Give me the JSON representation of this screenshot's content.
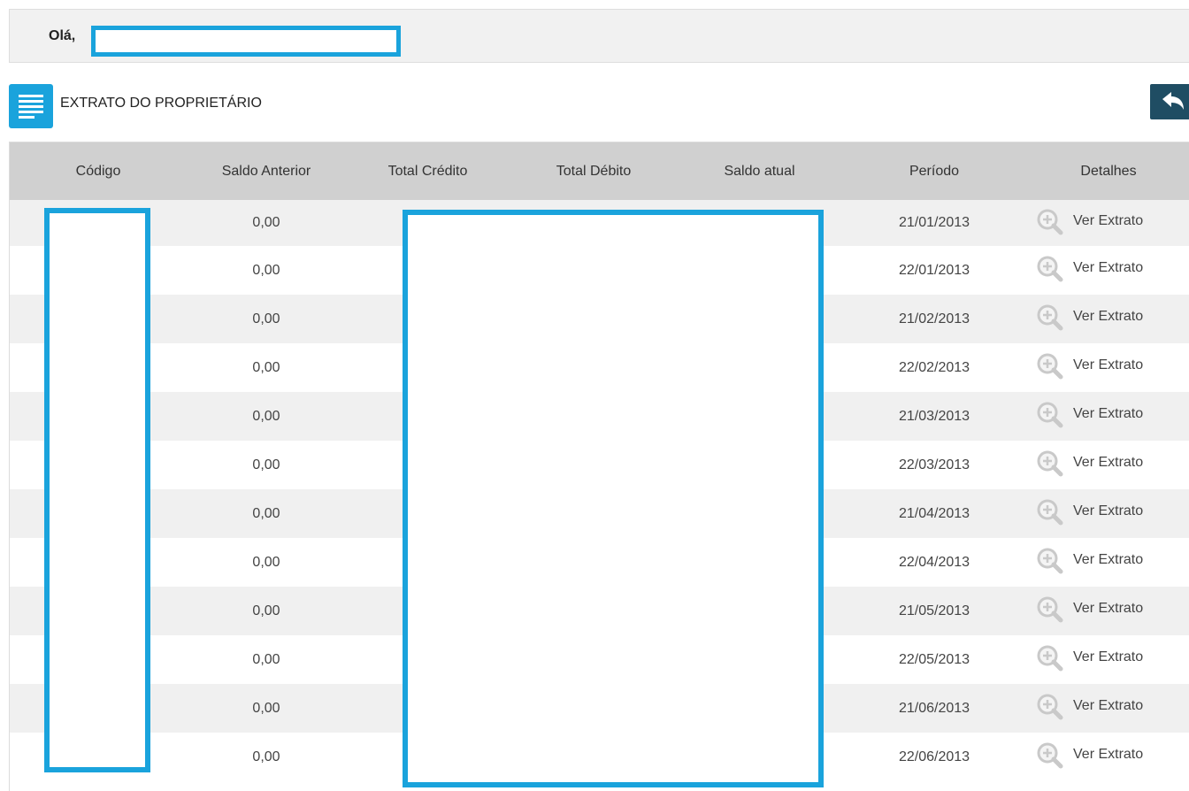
{
  "header": {
    "greeting": "Olá,"
  },
  "section": {
    "title": "EXTRATO DO PROPRIETÁRIO",
    "icon": "document-list-icon",
    "back_icon": "reply-arrow-icon"
  },
  "colors": {
    "accent": "#1aa3dc",
    "back_button": "#1f4d63",
    "header_row": "#d0d0d0",
    "row_alt": "#f0f0f0"
  },
  "table": {
    "columns": [
      "Código",
      "Saldo Anterior",
      "Total Crédito",
      "Total Débito",
      "Saldo atual",
      "Período",
      "Detalhes"
    ],
    "rows": [
      {
        "saldo_anterior": "0,00",
        "periodo": "21/01/2013",
        "detalhe": "Ver Extrato"
      },
      {
        "saldo_anterior": "0,00",
        "periodo": "22/01/2013",
        "detalhe": "Ver Extrato"
      },
      {
        "saldo_anterior": "0,00",
        "periodo": "21/02/2013",
        "detalhe": "Ver Extrato"
      },
      {
        "saldo_anterior": "0,00",
        "periodo": "22/02/2013",
        "detalhe": "Ver Extrato"
      },
      {
        "saldo_anterior": "0,00",
        "periodo": "21/03/2013",
        "detalhe": "Ver Extrato"
      },
      {
        "saldo_anterior": "0,00",
        "periodo": "22/03/2013",
        "detalhe": "Ver Extrato"
      },
      {
        "saldo_anterior": "0,00",
        "periodo": "21/04/2013",
        "detalhe": "Ver Extrato"
      },
      {
        "saldo_anterior": "0,00",
        "periodo": "22/04/2013",
        "detalhe": "Ver Extrato"
      },
      {
        "saldo_anterior": "0,00",
        "periodo": "21/05/2013",
        "detalhe": "Ver Extrato"
      },
      {
        "saldo_anterior": "0,00",
        "periodo": "22/05/2013",
        "detalhe": "Ver Extrato"
      },
      {
        "saldo_anterior": "0,00",
        "periodo": "21/06/2013",
        "detalhe": "Ver Extrato"
      },
      {
        "saldo_anterior": "0,00",
        "periodo": "22/06/2013",
        "detalhe": "Ver Extrato"
      }
    ]
  }
}
